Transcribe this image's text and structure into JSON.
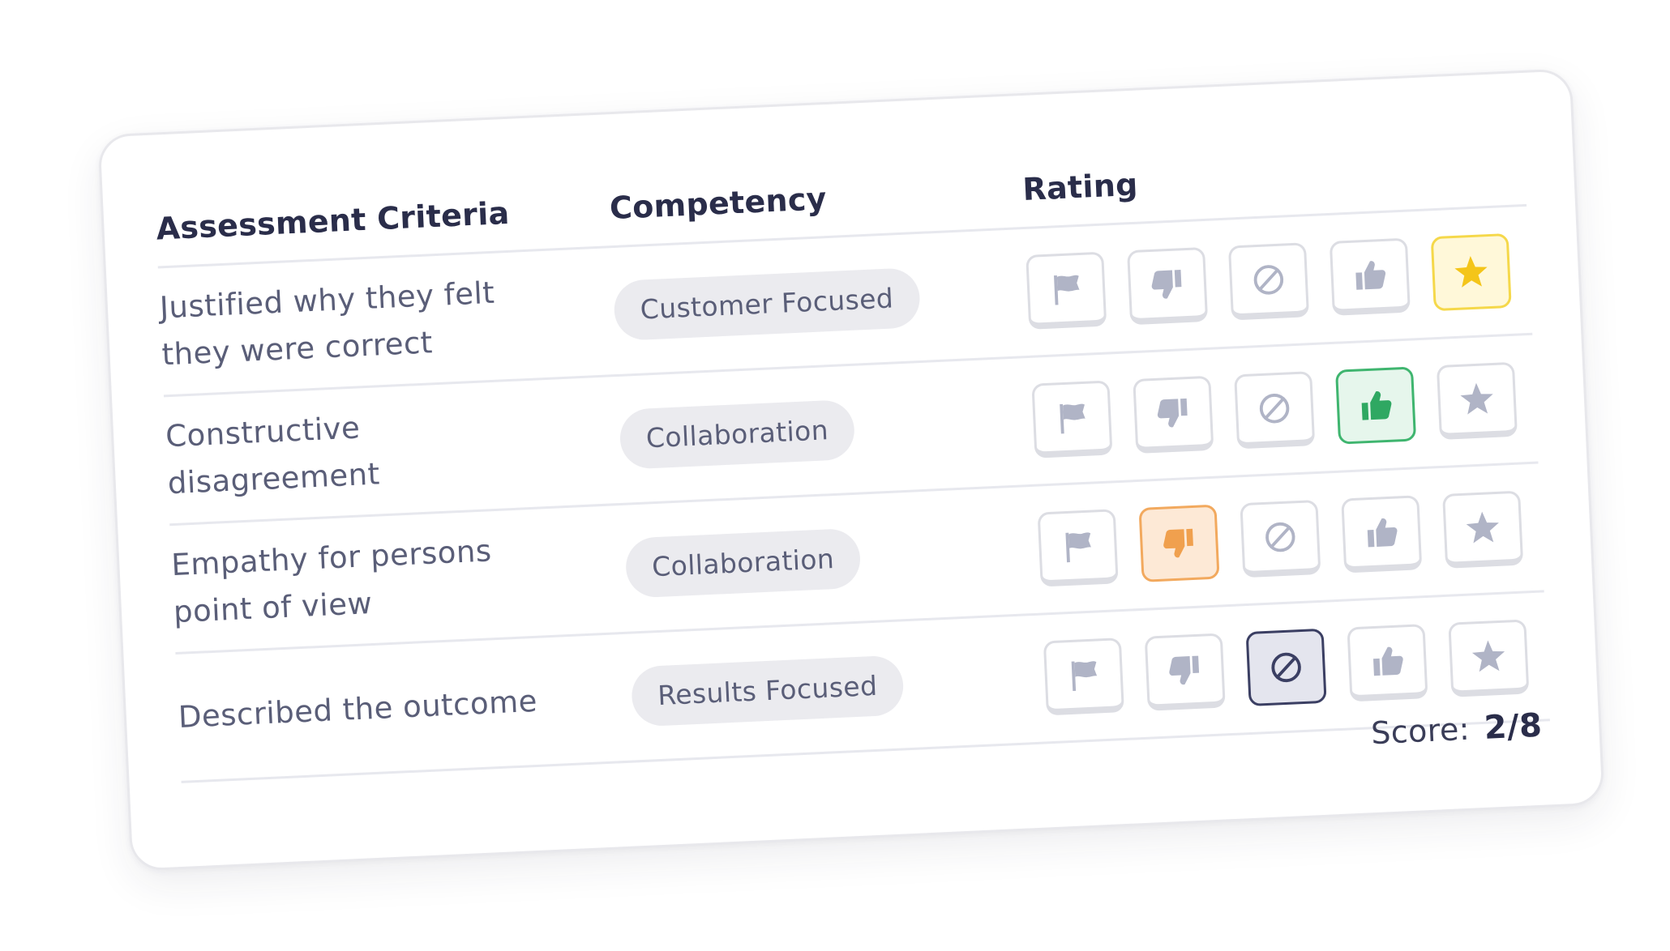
{
  "table": {
    "headers": {
      "criteria": "Assessment Criteria",
      "competency": "Competency",
      "rating": "Rating"
    },
    "rating_options": [
      "flag-icon",
      "thumbs-down-icon",
      "not-applicable-icon",
      "thumbs-up-icon",
      "star-icon"
    ],
    "rows": [
      {
        "criteria": "Justified why they felt they were correct",
        "competency": "Customer Focused",
        "selected_rating": "star"
      },
      {
        "criteria": "Constructive disagreement",
        "competency": "Collaboration",
        "selected_rating": "thumbs-up"
      },
      {
        "criteria": "Empathy for persons point of view",
        "competency": "Collaboration",
        "selected_rating": "thumbs-down"
      },
      {
        "criteria": "Described the outcome",
        "competency": "Results Focused",
        "selected_rating": "not-applicable"
      }
    ]
  },
  "score": {
    "label": "Score:",
    "value": "2/8"
  },
  "colors": {
    "star_selected": "#f4c519",
    "thumbs_up_selected": "#2fa862",
    "thumbs_down_selected": "#f0a04e",
    "not_applicable_selected": "#3b3f63",
    "icon_default": "#b0b4c6",
    "heading_text": "#2a2d4a",
    "body_text": "#5a5e78",
    "pill_background": "#ebebef"
  }
}
